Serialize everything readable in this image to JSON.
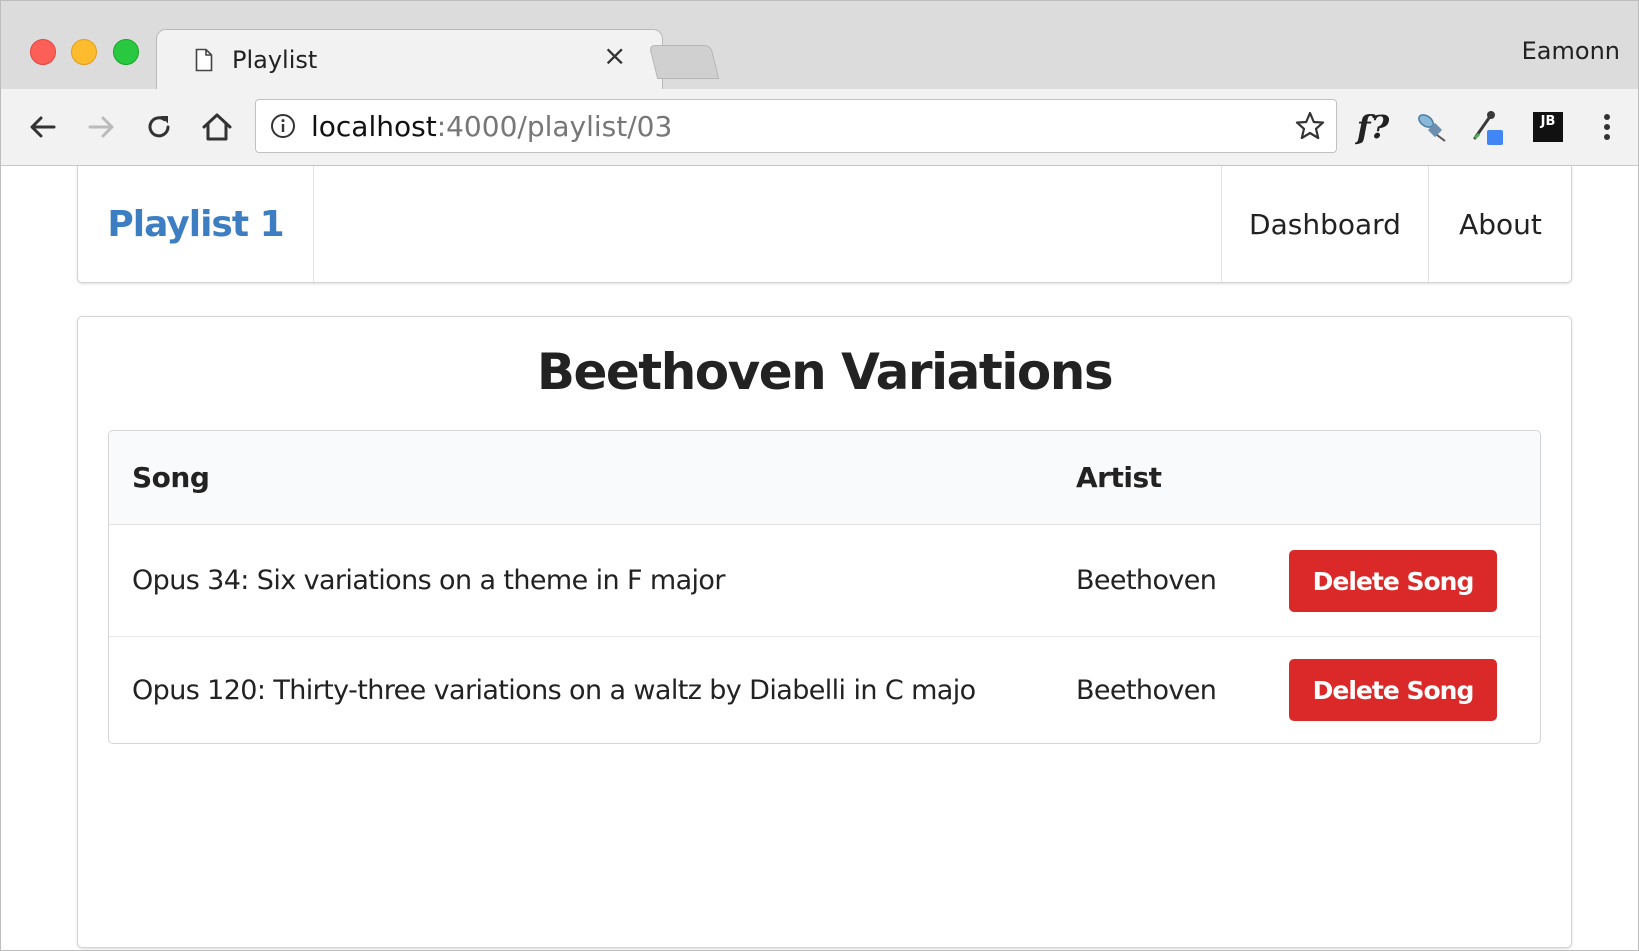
{
  "browser": {
    "tab_title": "Playlist",
    "tab_close": "×",
    "profile_name": "Eamonn",
    "url_host": "localhost",
    "url_path": ":4000/playlist/03",
    "extension_f_label": "f?",
    "extension_jb_label": "JB",
    "icons": [
      "back-arrow-icon",
      "forward-arrow-icon",
      "reload-icon",
      "home-icon",
      "info-icon",
      "star-icon",
      "menu-dots-icon"
    ]
  },
  "nav": {
    "brand": "Playlist 1",
    "items": [
      {
        "label": "Dashboard"
      },
      {
        "label": "About"
      }
    ]
  },
  "main": {
    "title": "Beethoven Variations",
    "table": {
      "headers": [
        "Song",
        "Artist",
        ""
      ],
      "rows": [
        {
          "song": "Opus 34: Six variations on a theme in F major",
          "artist": "Beethoven",
          "action": "Delete Song"
        },
        {
          "song": "Opus 120: Thirty-three variations on a waltz by Diabelli in C majo",
          "artist": "Beethoven",
          "action": "Delete Song"
        }
      ]
    }
  },
  "colors": {
    "brand": "#3c7ec1",
    "danger": "#db2828",
    "chrome_bg": "#dcdcdc"
  }
}
